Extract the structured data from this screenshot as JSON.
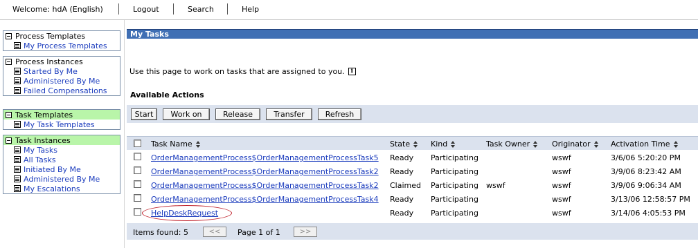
{
  "topbar": {
    "welcome": "Welcome: hdA (English)",
    "logout": "Logout",
    "search": "Search",
    "help": "Help"
  },
  "nav": {
    "process_templates": {
      "title": "Process Templates",
      "items": [
        "My Process Templates"
      ]
    },
    "process_instances": {
      "title": "Process Instances",
      "items": [
        "Started By Me",
        "Administered By Me",
        "Failed Compensations"
      ]
    },
    "task_templates": {
      "title": "Task Templates",
      "items": [
        "My Task Templates"
      ]
    },
    "task_instances": {
      "title": "Task Instances",
      "items": [
        "My Tasks",
        "All Tasks",
        "Initiated By Me",
        "Administered By Me",
        "My Escalations"
      ]
    }
  },
  "main": {
    "title": "My Tasks",
    "intro": "Use this page to work on tasks that are assigned to you.",
    "available_actions": "Available Actions",
    "actions": [
      "Start",
      "Work on",
      "Release",
      "Transfer",
      "Refresh"
    ]
  },
  "table": {
    "columns": [
      "Task Name",
      "State",
      "Kind",
      "Task Owner",
      "Originator",
      "Activation Time"
    ],
    "rows": [
      [
        "OrderManagementProcess$OrderManagementProcessTask5",
        "Ready",
        "Participating",
        "",
        "wswf",
        "3/6/06 5:20:20 PM"
      ],
      [
        "OrderManagementProcess$OrderManagementProcessTask2",
        "Ready",
        "Participating",
        "",
        "wswf",
        "3/9/06 8:23:42 AM"
      ],
      [
        "OrderManagementProcess$OrderManagementProcessTask2",
        "Claimed",
        "Participating",
        "wswf",
        "wswf",
        "3/9/06 9:06:34 AM"
      ],
      [
        "OrderManagementProcess$OrderManagementProcessTask4",
        "Ready",
        "Participating",
        "",
        "wswf",
        "3/13/06 12:58:57 PM"
      ],
      [
        "HelpDeskRequest",
        "Ready",
        "Participating",
        "",
        "wswf",
        "3/14/06 4:05:53 PM"
      ]
    ]
  },
  "footer": {
    "items_found": "Items found: 5",
    "prev": "<<",
    "page": "Page 1 of 1",
    "next": ">>"
  },
  "colors": {
    "title_bar": "#3f6fb4",
    "green_header": "#b9f5a9",
    "band": "#dbe2ee",
    "link": "#1a3bbd",
    "highlight_circle": "#c0202a"
  }
}
